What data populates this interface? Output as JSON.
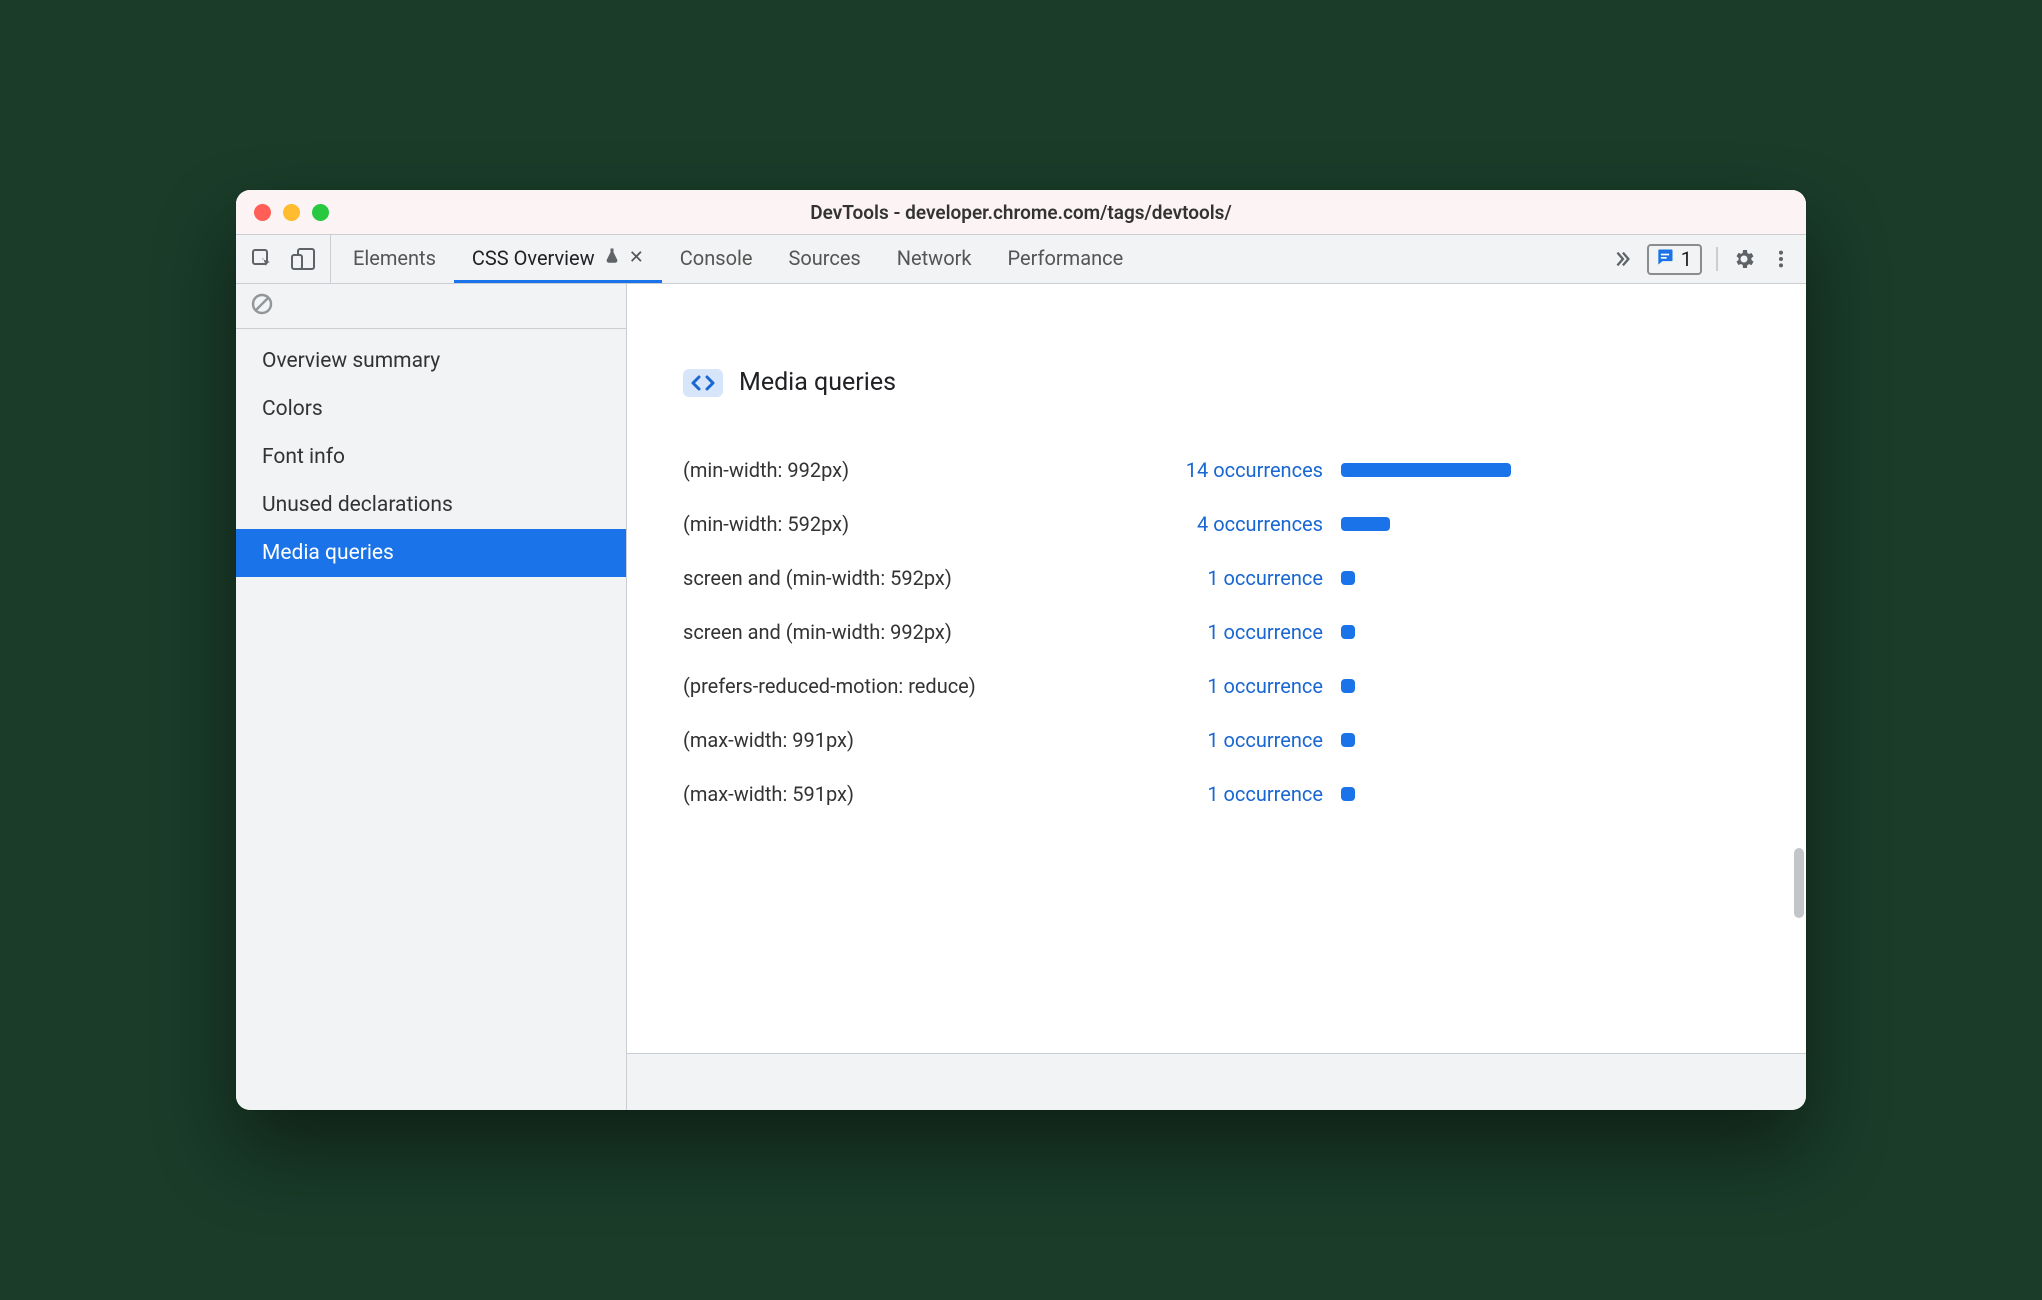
{
  "window_title": "DevTools - developer.chrome.com/tags/devtools/",
  "tabs": [
    {
      "label": "Elements",
      "active": false,
      "experiment": false,
      "closable": false
    },
    {
      "label": "CSS Overview",
      "active": true,
      "experiment": true,
      "closable": true
    },
    {
      "label": "Console",
      "active": false,
      "experiment": false,
      "closable": false
    },
    {
      "label": "Sources",
      "active": false,
      "experiment": false,
      "closable": false
    },
    {
      "label": "Network",
      "active": false,
      "experiment": false,
      "closable": false
    },
    {
      "label": "Performance",
      "active": false,
      "experiment": false,
      "closable": false
    }
  ],
  "more_tabs": true,
  "issues_count": "1",
  "sidebar": [
    {
      "label": "Overview summary",
      "selected": false
    },
    {
      "label": "Colors",
      "selected": false
    },
    {
      "label": "Font info",
      "selected": false
    },
    {
      "label": "Unused declarations",
      "selected": false
    },
    {
      "label": "Media queries",
      "selected": true
    }
  ],
  "panel_heading": "Media queries",
  "media_queries": [
    {
      "query": "(min-width: 992px)",
      "count": 14,
      "text": "14 occurrences"
    },
    {
      "query": "(min-width: 592px)",
      "count": 4,
      "text": "4 occurrences"
    },
    {
      "query": "screen and (min-width: 592px)",
      "count": 1,
      "text": "1 occurrence"
    },
    {
      "query": "screen and (min-width: 992px)",
      "count": 1,
      "text": "1 occurrence"
    },
    {
      "query": "(prefers-reduced-motion: reduce)",
      "count": 1,
      "text": "1 occurrence"
    },
    {
      "query": "(max-width: 991px)",
      "count": 1,
      "text": "1 occurrence"
    },
    {
      "query": "(max-width: 591px)",
      "count": 1,
      "text": "1 occurrence"
    }
  ],
  "chart_data": {
    "type": "bar",
    "title": "Media queries",
    "xlabel": "",
    "ylabel": "Occurrences",
    "categories": [
      "(min-width: 992px)",
      "(min-width: 592px)",
      "screen and (min-width: 592px)",
      "screen and (min-width: 992px)",
      "(prefers-reduced-motion: reduce)",
      "(max-width: 991px)",
      "(max-width: 591px)"
    ],
    "values": [
      14,
      4,
      1,
      1,
      1,
      1,
      1
    ],
    "ylim": [
      0,
      14
    ]
  },
  "colors": {
    "accent": "#1a73e8",
    "link": "#1967d2",
    "toolbar": "#f1f3f4"
  }
}
